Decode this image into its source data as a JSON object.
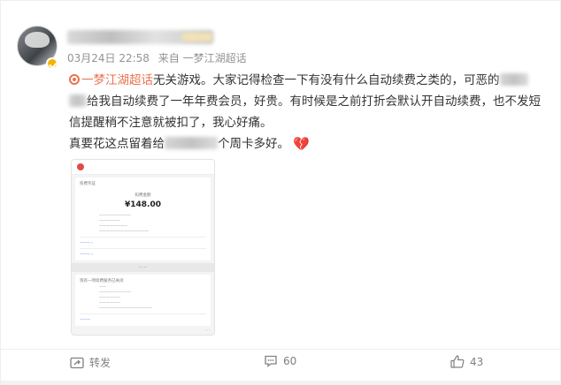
{
  "post": {
    "meta": {
      "time": "03月24日 22:58",
      "source": "来自 一梦江湖超话"
    },
    "topic": "一梦江湖超话",
    "text_1": "无关游戏。大家记得检查一下有没有什么自动续费之类的，可恶的",
    "text_2": "给我自动续费了一年年费会员，好贵。有时候是之前打折会默认开自动续费，也不发短信提醒稍不注意就被扣了，我心好痛。",
    "text_3_a": "真要花这点留着给",
    "text_3_b": "个周卡多好。",
    "emoji": "broken-heart"
  },
  "receipt": {
    "app_label": "",
    "section_label": "扣费凭证",
    "amount_label": "扣费金额",
    "amount": "¥148.00",
    "section2_title": "现有一项续费服务已关闭"
  },
  "actions": {
    "repost_label": "转发",
    "comment_count": "60",
    "like_count": "43"
  },
  "colors": {
    "topic": "#eb7350",
    "meta": "#939393",
    "action": "#808080"
  }
}
